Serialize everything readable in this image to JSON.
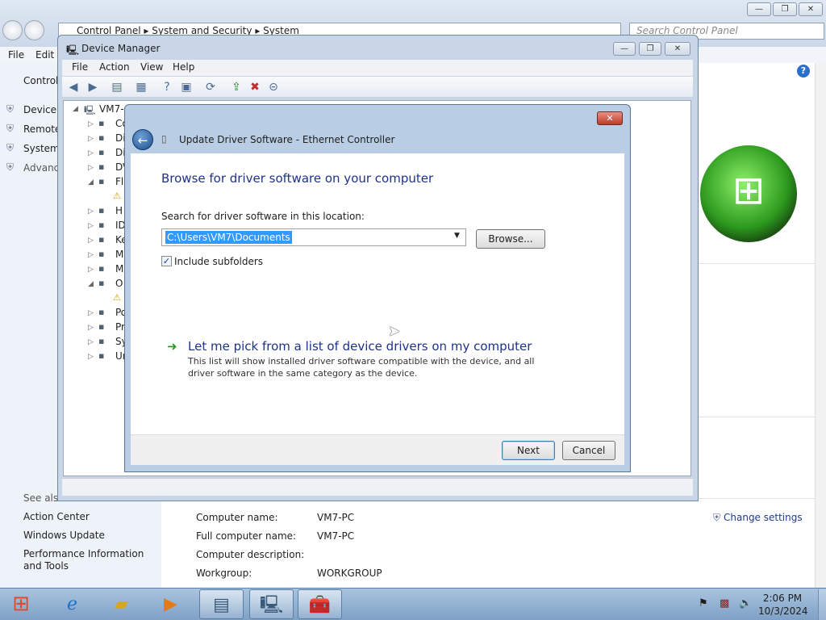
{
  "control_panel": {
    "breadcrumb": [
      "Control Panel",
      "System and Security",
      "System"
    ],
    "search_placeholder": "Search Control Panel",
    "menu": [
      "File",
      "Edit"
    ],
    "left_nav": {
      "home": "Control",
      "items": [
        "Device M",
        "Remote",
        "System",
        "Advanc"
      ],
      "see_also_label": "See also",
      "see_also": [
        "Action Center",
        "Windows Update",
        "Performance Information and Tools"
      ]
    },
    "computer_info": [
      {
        "label": "Computer name:",
        "value": "VM7-PC"
      },
      {
        "label": "Full computer name:",
        "value": "VM7-PC"
      },
      {
        "label": "Computer description:",
        "value": ""
      },
      {
        "label": "Workgroup:",
        "value": "WORKGROUP"
      }
    ],
    "change_settings": "Change settings"
  },
  "device_manager": {
    "title": "Device Manager",
    "menu": [
      "File",
      "Action",
      "View",
      "Help"
    ],
    "root": "VM7-",
    "tree": [
      "Co",
      "Di",
      "Di",
      "DV",
      "Fl",
      "",
      "H",
      "ID",
      "Ke",
      "M",
      "M",
      "O",
      "",
      "Po",
      "Pr",
      "Sy",
      "Ur"
    ]
  },
  "dialog": {
    "title": "Update Driver Software - Ethernet Controller",
    "heading": "Browse for driver software on your computer",
    "search_label": "Search for driver software in this location:",
    "path_value": "C:\\Users\\VM7\\Documents",
    "browse_label": "Browse...",
    "include_subfolders": "Include subfolders",
    "include_checked": true,
    "pick_title": "Let me pick from a list of device drivers on my computer",
    "pick_desc": "This list will show installed driver software compatible with the device, and all driver software in the same category as the device.",
    "next_label": "Next",
    "cancel_label": "Cancel"
  },
  "taskbar": {
    "time": "2:06 PM",
    "date": "10/3/2024"
  },
  "colors": {
    "accent": "#1e3287",
    "selection": "#3399ff",
    "link": "#1e3c8a"
  }
}
